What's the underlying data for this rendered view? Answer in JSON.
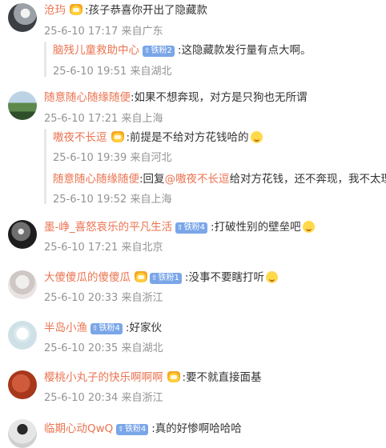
{
  "comments": [
    {
      "username": "沧玙",
      "text": ":孩子恭喜你开出了隐藏款",
      "time": "25-6-10 17:17",
      "location": "来自广东",
      "replies": [
        {
          "username": "脑残儿童救助中心",
          "badge": "铁粉2",
          "text": ":这隐藏款发行量有点大啊。",
          "time": "25-6-10 19:51",
          "location": "来自湖北"
        }
      ]
    },
    {
      "username": "随意随心随缘随便",
      "text": ":如果不想奔现，对方是只狗也无所谓",
      "time": "25-6-10 17:21",
      "location": "来自上海",
      "replies": [
        {
          "username": "嗷夜不长逗",
          "text": ":前提是不给对方花钱哈的",
          "time": "25-6-10 19:39",
          "location": "来自河北"
        },
        {
          "username": "随意随心随缘随便",
          "text_prefix": ":回复",
          "mention": "@嗷夜不长逗",
          "text": "给对方花钱，还不奔现，我不太理解",
          "time": "25-6-10 19:52",
          "location": "来自上海"
        }
      ]
    },
    {
      "username": "墨-峥_喜怒哀乐的平凡生活",
      "badge": "铁粉4",
      "text": ":打破性别的壁垒吧",
      "time": "25-6-10 17:21",
      "location": "来自北京"
    },
    {
      "username": "大傻傻瓜的傻傻瓜",
      "badge": "铁粉1",
      "text": ":没事不要瞎打听",
      "time": "25-6-10 20:33",
      "location": "来自浙江"
    },
    {
      "username": "半岛小渔",
      "badge": "铁粉4",
      "text": ":好家伙",
      "time": "25-6-10 20:35",
      "location": "来自湖北"
    },
    {
      "username": "樱桃小丸子的快乐啊啊啊",
      "text": ":要不就直接面基",
      "time": "25-6-10 20:34",
      "location": "来自浙江"
    },
    {
      "username": "临期心动QwQ",
      "badge": "铁粉4",
      "text": ":真的好惨啊哈哈哈"
    }
  ],
  "icons": {
    "crown": "crown-badge-icon",
    "fan_badge_arrow": "up-arrow-icon",
    "emoji": "emoji-icon"
  },
  "colors": {
    "username": "#eb7350",
    "badge": "#7aa6e8",
    "meta": "#939393"
  }
}
